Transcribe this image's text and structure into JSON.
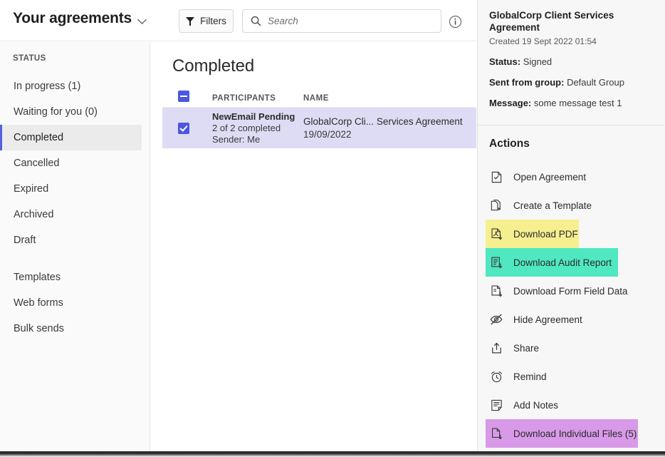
{
  "topbar": {
    "page_title": "Your agreements",
    "title_chevron_icon": "chevron-down-icon",
    "filters_label": "Filters",
    "filters_icon": "filter-funnel-icon",
    "search_placeholder": "Search",
    "search_value": "",
    "search_icon": "search-icon",
    "info_icon": "info-circle-icon"
  },
  "sidebar": {
    "section_label": "STATUS",
    "items": [
      {
        "label": "In progress (1)",
        "active": false
      },
      {
        "label": "Waiting for you (0)",
        "active": false
      },
      {
        "label": "Completed",
        "active": true
      },
      {
        "label": "Cancelled",
        "active": false
      },
      {
        "label": "Expired",
        "active": false
      },
      {
        "label": "Archived",
        "active": false
      },
      {
        "label": "Draft",
        "active": false
      }
    ],
    "items2": [
      {
        "label": "Templates",
        "active": false
      },
      {
        "label": "Web forms",
        "active": false
      },
      {
        "label": "Bulk sends",
        "active": false
      }
    ]
  },
  "main": {
    "heading": "Completed",
    "table": {
      "select_all_state": "indeterminate",
      "columns": [
        "PARTICIPANTS",
        "NAME"
      ],
      "rows": [
        {
          "selected": true,
          "participants_name": "NewEmail Pending",
          "participants_progress": "2 of 2 completed",
          "participants_sender": "Sender: Me",
          "name_truncated": "GlobalCorp Cli...",
          "name_overflow": "Services Agreement",
          "name_date": "19/09/2022"
        }
      ]
    }
  },
  "detail": {
    "title": "GlobalCorp Client Services Agreement",
    "created": "Created 19 Sept 2022 01:54",
    "meta": [
      {
        "key": "Status:",
        "value": "Signed"
      },
      {
        "key": "Sent from group:",
        "value": "Default Group"
      },
      {
        "key": "Message:",
        "value": "some message test 1"
      }
    ],
    "actions_title": "Actions",
    "actions": [
      {
        "label": "Open Agreement",
        "icon": "document-check-icon",
        "highlight": "none"
      },
      {
        "label": "Create a Template",
        "icon": "document-copy-icon",
        "highlight": "none"
      },
      {
        "label": "Download PDF",
        "icon": "pdf-download-icon",
        "highlight": "yellow"
      },
      {
        "label": "Download Audit Report",
        "icon": "audit-report-download-icon",
        "highlight": "teal"
      },
      {
        "label": "Download Form Field Data",
        "icon": "form-data-download-icon",
        "highlight": "none"
      },
      {
        "label": "Hide Agreement",
        "icon": "eye-slash-icon",
        "highlight": "none"
      },
      {
        "label": "Share",
        "icon": "share-upload-icon",
        "highlight": "none"
      },
      {
        "label": "Remind",
        "icon": "alarm-clock-icon",
        "highlight": "none"
      },
      {
        "label": "Add Notes",
        "icon": "notes-icon",
        "highlight": "none"
      },
      {
        "label": "Download Individual Files (5)",
        "icon": "file-download-icon",
        "highlight": "purple"
      }
    ]
  },
  "colors": {
    "accent_blue": "#5560e0",
    "checkbox_blue": "#4a58e0",
    "row_selected_bg": "#dedcf5",
    "highlight_yellow": "#f5ef8f",
    "highlight_teal": "#4fe8c0",
    "highlight_purple": "#d89ae8",
    "panel_bg": "#f7f7f7",
    "sidebar_bg": "#fafafa"
  }
}
